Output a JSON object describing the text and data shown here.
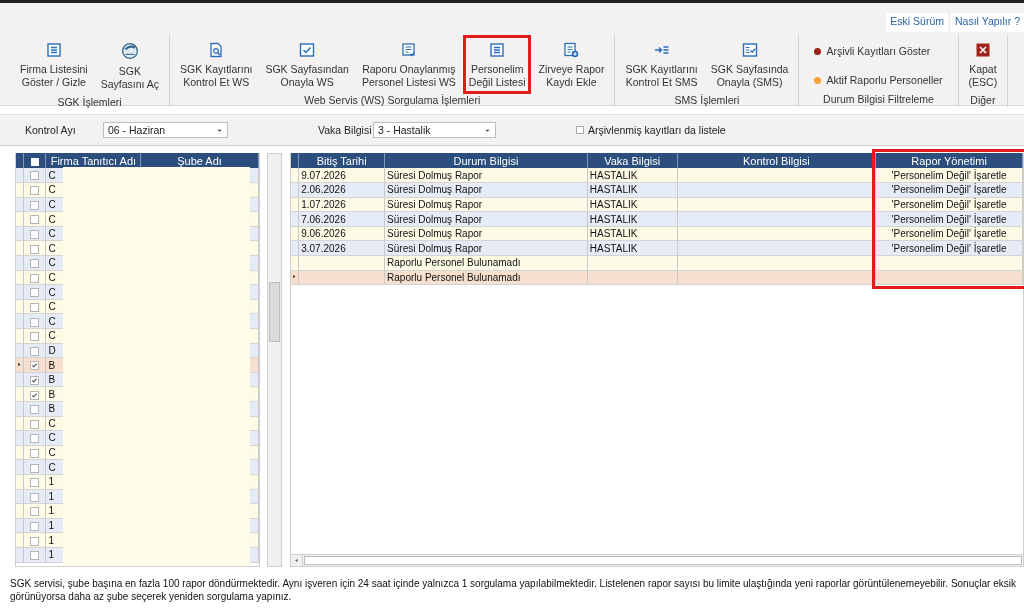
{
  "top_links": [
    "Eski Sürüm",
    "Nasıl Yapılır ?"
  ],
  "ribbon": [
    {
      "label": "SGK İşlemleri",
      "items": [
        {
          "kind": "button",
          "lines": [
            "Firma Listesini",
            "Göster / Gizle"
          ],
          "highlighted": false
        },
        {
          "kind": "button",
          "lines": [
            "SGK",
            "Sayfasını Aç"
          ],
          "highlighted": false
        }
      ]
    },
    {
      "label": "Web Servis (WS) Sorgulama İşlemleri",
      "items": [
        {
          "kind": "button",
          "lines": [
            "SGK Kayıtlarını",
            "Kontrol Et WS"
          ],
          "highlighted": false
        },
        {
          "kind": "button",
          "lines": [
            "SGK Sayfasından",
            "Onayla WS"
          ],
          "highlighted": false
        },
        {
          "kind": "button",
          "lines": [
            "Raporu Onaylanmış",
            "Personel Listesi WS"
          ],
          "highlighted": false
        },
        {
          "kind": "button",
          "lines": [
            "Personelim",
            "Değil Listesi"
          ],
          "highlighted": true
        },
        {
          "kind": "button",
          "lines": [
            "Zirveye Rapor",
            "Kaydı Ekle"
          ],
          "highlighted": false
        }
      ]
    },
    {
      "label": "SMS İşlemleri",
      "items": [
        {
          "kind": "button",
          "lines": [
            "SGK Kayıtlarını",
            "Kontrol Et SMS"
          ],
          "highlighted": false
        },
        {
          "kind": "button",
          "lines": [
            "SGK Sayfasında",
            "Onayla (SMS)"
          ],
          "highlighted": false
        }
      ]
    },
    {
      "label": "Durum Bilgisi Filtreleme",
      "items": [
        {
          "kind": "filter",
          "label": "Arşivli Kayıtları Göster",
          "color": "#9b1f1a"
        },
        {
          "kind": "filter",
          "label": "Aktif Raporlu Personeller",
          "color": "#f5a33a"
        }
      ]
    },
    {
      "label": "Diğer",
      "items": [
        {
          "kind": "close",
          "lines": [
            "Kapat",
            "(ESC)"
          ],
          "highlighted": false
        }
      ]
    }
  ],
  "filters": {
    "kontrol_ayi": {
      "label": "Kontrol Ayı",
      "value": "06 - Haziran"
    },
    "vaka_bilgisi": {
      "label": "Vaka Bilgisi",
      "value": "3 - Hastalik"
    },
    "archive_checkbox": {
      "label": "Arşivlenmiş kayıtları da listele",
      "checked": false
    }
  },
  "left_grid": {
    "select_all": {
      "checked": false
    },
    "columns": [
      "Firma Tanıtıcı Adı",
      "Şube Adı"
    ],
    "redacted": true,
    "rows": [
      {
        "firma": "C",
        "checked": false,
        "selected": false
      },
      {
        "firma": "C",
        "checked": false,
        "selected": false
      },
      {
        "firma": "C",
        "checked": false,
        "selected": false
      },
      {
        "firma": "C",
        "checked": false,
        "selected": false
      },
      {
        "firma": "C",
        "checked": false,
        "selected": false
      },
      {
        "firma": "C",
        "checked": false,
        "selected": false
      },
      {
        "firma": "C",
        "checked": false,
        "selected": false
      },
      {
        "firma": "C",
        "checked": false,
        "selected": false
      },
      {
        "firma": "C",
        "checked": false,
        "selected": false
      },
      {
        "firma": "C",
        "checked": false,
        "selected": false
      },
      {
        "firma": "C",
        "checked": false,
        "selected": false
      },
      {
        "firma": "C",
        "checked": false,
        "selected": false
      },
      {
        "firma": "D",
        "checked": false,
        "selected": false
      },
      {
        "firma": "B",
        "checked": true,
        "selected": true
      },
      {
        "firma": "B",
        "checked": true,
        "selected": false
      },
      {
        "firma": "B",
        "checked": true,
        "selected": false
      },
      {
        "firma": "B",
        "checked": false,
        "selected": false
      },
      {
        "firma": "C",
        "checked": false,
        "selected": false
      },
      {
        "firma": "C",
        "checked": false,
        "selected": false
      },
      {
        "firma": "C",
        "checked": false,
        "selected": false
      },
      {
        "firma": "C",
        "checked": false,
        "selected": false
      },
      {
        "firma": "1",
        "checked": false,
        "selected": false
      },
      {
        "firma": "1",
        "checked": false,
        "selected": false
      },
      {
        "firma": "1",
        "checked": false,
        "selected": false
      },
      {
        "firma": "1",
        "checked": false,
        "selected": false
      },
      {
        "firma": "1",
        "checked": false,
        "selected": false
      },
      {
        "firma": "1",
        "checked": false,
        "selected": false
      }
    ]
  },
  "report_grid": {
    "columns": [
      {
        "label": "Bitiş Tarihi",
        "highlighted": false
      },
      {
        "label": "Durum Bilgisi",
        "highlighted": false
      },
      {
        "label": "Vaka Bilgisi",
        "highlighted": false
      },
      {
        "label": "Kontrol Bilgisi",
        "highlighted": false
      },
      {
        "label": "Rapor Yönetimi",
        "highlighted": true
      }
    ],
    "rows": [
      {
        "bitis": "9.07.2026",
        "durum": "Süresi Dolmuş Rapor",
        "vaka": "HASTALIK",
        "rapor": "'Personelim Değil' İşaretle",
        "selected": false
      },
      {
        "bitis": "2.06.2026",
        "durum": "Süresi Dolmuş Rapor",
        "vaka": "HASTALIK",
        "rapor": "'Personelim Değil' İşaretle",
        "selected": false
      },
      {
        "bitis": "1.07.2026",
        "durum": "Süresi Dolmuş Rapor",
        "vaka": "HASTALIK",
        "rapor": "'Personelim Değil' İşaretle",
        "selected": false
      },
      {
        "bitis": "7.06.2026",
        "durum": "Süresi Dolmuş Rapor",
        "vaka": "HASTALIK",
        "rapor": "'Personelim Değil' İşaretle",
        "selected": false
      },
      {
        "bitis": "9.06.2026",
        "durum": "Süresi Dolmuş Rapor",
        "vaka": "HASTALIK",
        "rapor": "'Personelim Değil' İşaretle",
        "selected": false
      },
      {
        "bitis": "3.07.2026",
        "durum": "Süresi Dolmuş Rapor",
        "vaka": "HASTALIK",
        "rapor": "'Personelim Değil' İşaretle",
        "selected": false
      },
      {
        "durum": "Raporlu Personel Bulunamadı",
        "selected": false
      },
      {
        "durum": "Raporlu Personel Bulunamadı",
        "selected": true
      }
    ]
  },
  "footer_note": "SGK servisi, şube başına en fazla 100 rapor döndürmektedir. Aynı işveren için 24 saat içinde yalnızca 1 sorgulama yapılabilmektedir. Listelenen rapor sayısı bu limite ulaştığında yeni raporlar görüntülenemeyebilir. Sonuçlar eksik görünüyorsa daha az şube seçerek yeniden sorgulama yapınız."
}
